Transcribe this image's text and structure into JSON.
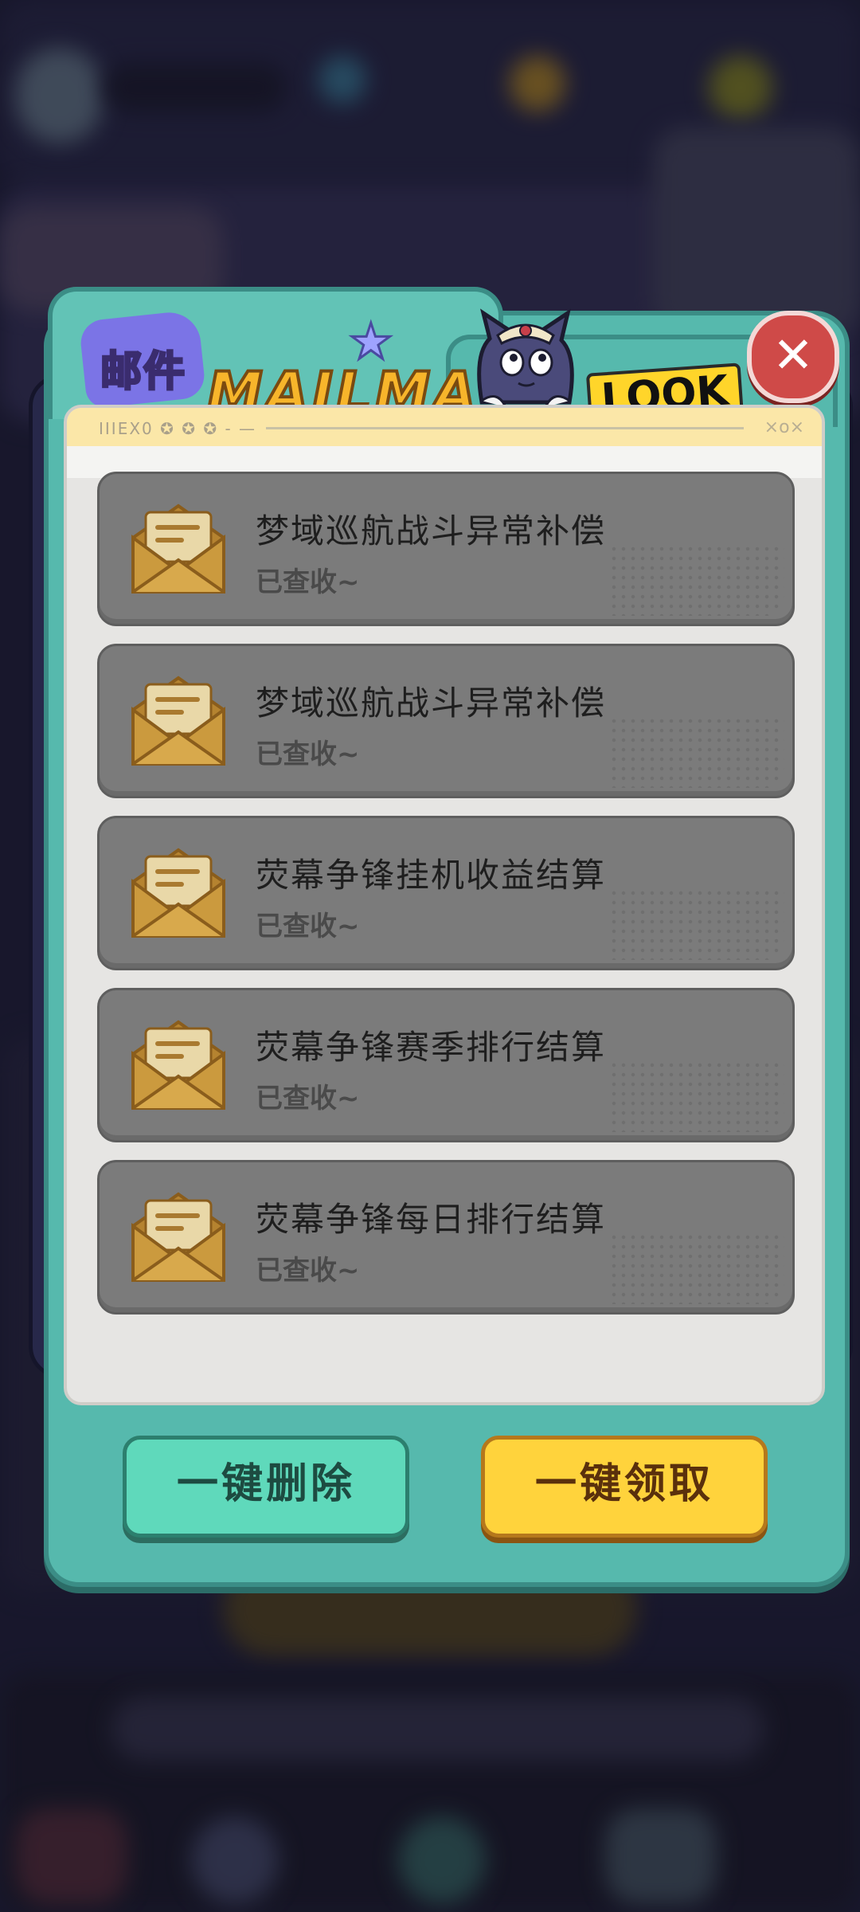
{
  "dialog": {
    "title": "邮件",
    "title_en": "MAILMA",
    "look_label": "LOOK",
    "close_label": "✕"
  },
  "panel": {
    "deco_left": "IIIEX0 ✪ ✪ ✪ - —",
    "deco_right": "×o×"
  },
  "mails": [
    {
      "title": "梦域巡航战斗异常补偿",
      "status": "已查收~"
    },
    {
      "title": "梦域巡航战斗异常补偿",
      "status": "已查收~"
    },
    {
      "title": "荧幕争锋挂机收益结算",
      "status": "已查收~"
    },
    {
      "title": "荧幕争锋赛季排行结算",
      "status": "已查收~"
    },
    {
      "title": "荧幕争锋每日排行结算",
      "status": "已查收~"
    }
  ],
  "buttons": {
    "delete_all": "一键删除",
    "claim_all": "一键领取"
  },
  "colors": {
    "frame": "#56b9ad",
    "close": "#cf4a48",
    "delete_button": "#5fd9bb",
    "claim_button": "#ffd33c",
    "mail_item": "#7b7b7b"
  }
}
